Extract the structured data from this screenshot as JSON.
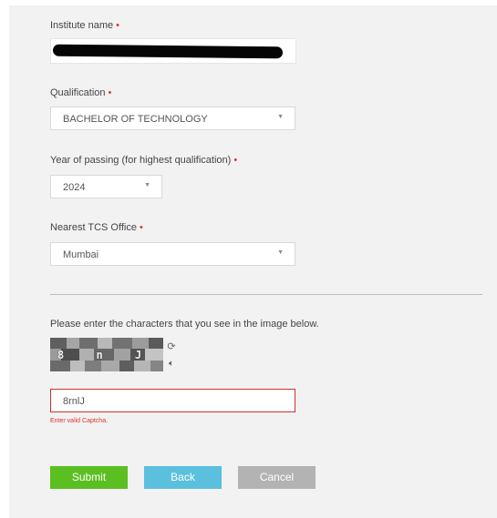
{
  "form": {
    "institute_label": "Institute name",
    "required_mark": "•",
    "qualification_label": "Qualification",
    "qualification_value": "BACHELOR OF TECHNOLOGY",
    "year_label": "Year of passing (for highest qualification)",
    "year_value": "2024",
    "office_label": "Nearest TCS Office",
    "office_value": "Mumbai"
  },
  "captcha": {
    "instruction": "Please enter the characters that you see in the image below.",
    "image_chars": "8 n J",
    "input_value": "8rnlJ",
    "error_text": "Enter valid Captcha.",
    "refresh_icon": "refresh-icon",
    "audio_icon": "speaker-icon"
  },
  "buttons": {
    "submit": "Submit",
    "back": "Back",
    "cancel": "Cancel"
  },
  "colors": {
    "panel": "#f2f2f2",
    "required": "#e0322d",
    "submit": "#5bbf21",
    "back": "#5bc0de",
    "cancel": "#b3b3b3",
    "error_border": "#d32f2f"
  }
}
